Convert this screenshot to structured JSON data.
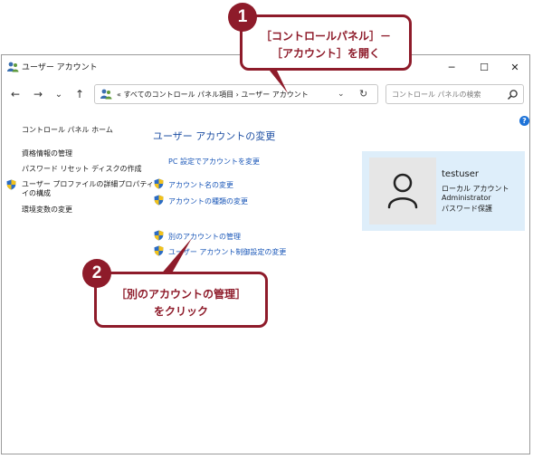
{
  "window": {
    "title": "ユーザー アカウント",
    "controls": {
      "minimize": "─",
      "maximize": "☐",
      "close": "✕"
    }
  },
  "nav": {
    "back": "←",
    "forward": "→",
    "dropdown": "⌄",
    "up": "↑"
  },
  "address": {
    "prefix": "«",
    "crumb1": "すべてのコントロール パネル項目",
    "sep": "›",
    "crumb2": "ユーザー アカウント",
    "chevron": "⌄",
    "refresh": "↻"
  },
  "search": {
    "placeholder": "コントロール パネルの検索"
  },
  "help": "?",
  "sidebar": {
    "home": "コントロール パネル ホーム",
    "items": [
      "資格情報の管理",
      "パスワード リセット ディスクの作成",
      "ユーザー プロファイルの詳細プロパティ",
      "イの構成",
      "環境変数の変更"
    ]
  },
  "main": {
    "title": "ユーザー アカウントの変更",
    "tasks": [
      "PC 設定でアカウントを変更",
      "アカウント名の変更",
      "アカウントの種類の変更"
    ],
    "other_tasks": [
      "別のアカウントの管理",
      "ユーザー アカウント制御設定の変更"
    ]
  },
  "user": {
    "name": "testuser",
    "type": "ローカル アカウント",
    "role": "Administrator",
    "password": "パスワード保護"
  },
  "callouts": [
    {
      "number": "1",
      "line1": "［コントロールパネル］－",
      "line2": "［アカウント］を開く"
    },
    {
      "number": "2",
      "line1": "［別のアカウントの管理］",
      "line2": "をクリック"
    }
  ],
  "colors": {
    "accent": "#8e1b2a",
    "link": "#1a57b8",
    "title": "#1e4fa3",
    "card": "#deeefa"
  }
}
